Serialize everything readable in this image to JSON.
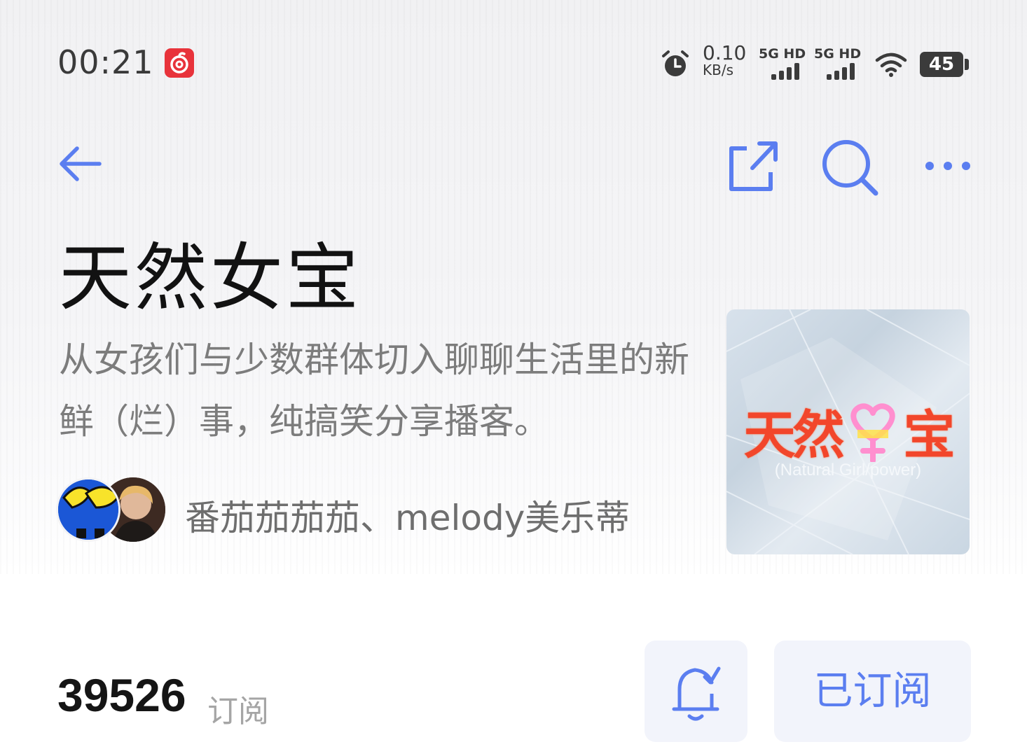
{
  "status_bar": {
    "time": "00:21",
    "net_speed_value": "0.10",
    "net_speed_unit": "KB/s",
    "sim1_label": "5G HD",
    "sim2_label": "5G HD",
    "battery": "45",
    "icons": [
      "netease-music-app-icon",
      "alarm-icon",
      "signal-icon",
      "wifi-icon",
      "battery-icon"
    ]
  },
  "nav": {
    "icons": [
      "back-arrow-icon",
      "share-icon",
      "search-icon",
      "more-icon"
    ],
    "accent_color": "#5b7ef0"
  },
  "podcast": {
    "title": "天然女宝",
    "description": "从女孩们与少数群体切入聊聊生活里的新鲜（烂）事，纯搞笑分享播客。",
    "hosts": "番茄茄茄茄、melody美乐蒂",
    "cover": {
      "title_part1": "天然",
      "title_part2": "宝",
      "subtitle": "(Natural Girl/power)"
    }
  },
  "subscription": {
    "count": "39526",
    "count_label": "订阅",
    "subscribed_label": "已订阅"
  }
}
